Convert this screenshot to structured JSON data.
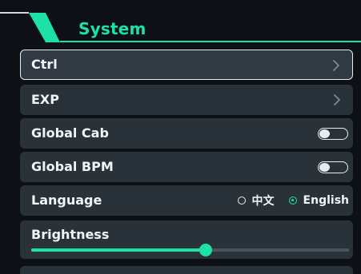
{
  "header": {
    "title": "System",
    "accent_color": "#1de2a7"
  },
  "menu": {
    "ctrl": {
      "label": "Ctrl",
      "icon": "chevron-right-icon"
    },
    "exp": {
      "label": "EXP",
      "icon": "chevron-right-icon"
    },
    "global_cab": {
      "label": "Global Cab",
      "toggle_on": false
    },
    "global_bpm": {
      "label": "Global BPM",
      "toggle_on": false
    },
    "language": {
      "label": "Language",
      "options": [
        {
          "label": "中文",
          "selected": false
        },
        {
          "label": "English",
          "selected": true
        }
      ]
    },
    "brightness": {
      "label": "Brightness",
      "value_percent": 55
    }
  }
}
